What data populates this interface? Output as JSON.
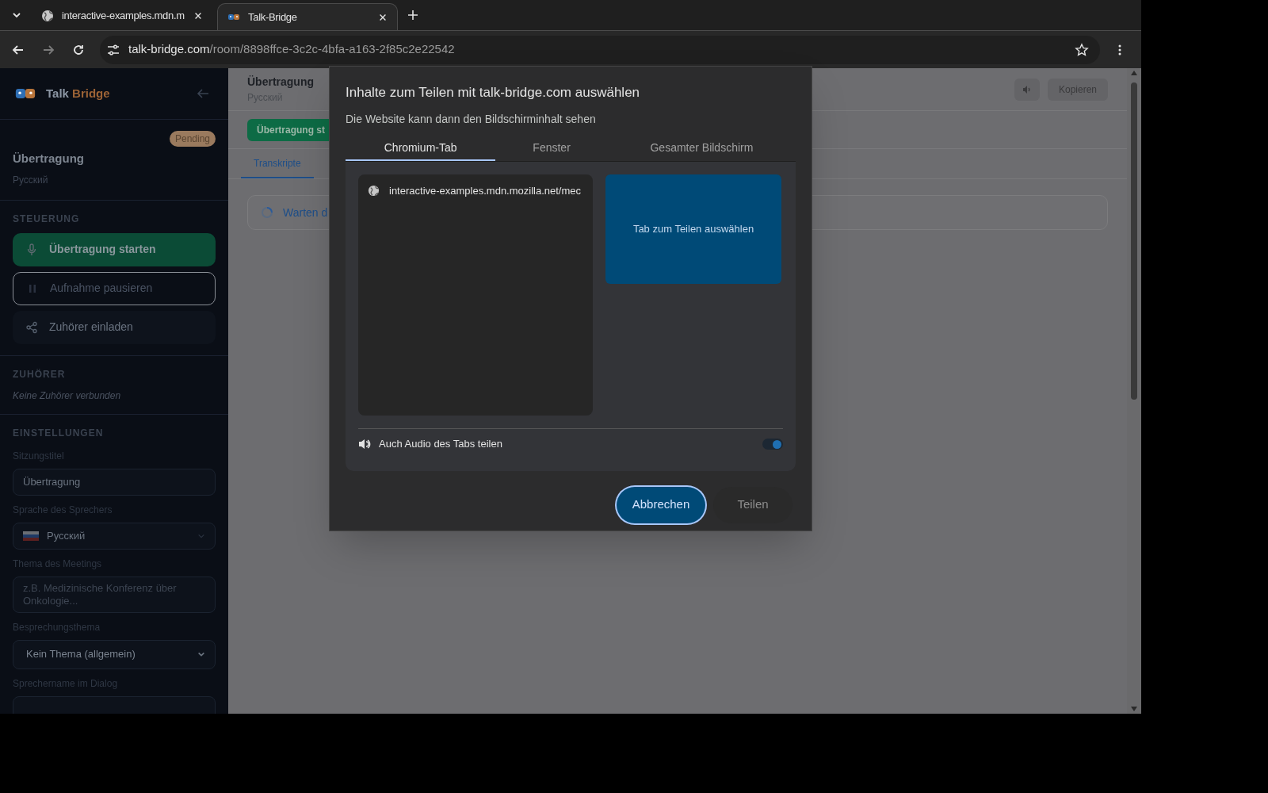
{
  "browser": {
    "tabs": [
      {
        "title": "interactive-examples.mdn.m",
        "selected": false
      },
      {
        "title": "Talk-Bridge",
        "selected": true
      }
    ],
    "address": {
      "host": "talk-bridge.com",
      "path": "/room/8898ffce-3c2c-4bfa-a163-2f85c2e22542"
    }
  },
  "sidebar": {
    "brand": {
      "first": "Talk",
      "second": "Bridge"
    },
    "status": "Pending",
    "session_title": "Übertragung",
    "session_language": "Русский",
    "sections": [
      {
        "heading": "STEUERUNG",
        "buttons": [
          {
            "label": "Übertragung starten",
            "kind": "primary"
          },
          {
            "label": "Aufnahme pausieren",
            "kind": "outline"
          },
          {
            "label": "Zuhörer einladen",
            "kind": "ghost"
          }
        ]
      },
      {
        "heading": "ZUHÖRER",
        "note": "Keine Zuhörer verbunden"
      },
      {
        "heading": "EINSTELLUNGEN",
        "fields": [
          {
            "label": "Sitzungstitel",
            "kind": "input",
            "value": "Übertragung"
          },
          {
            "label": "Sprache des Sprechers",
            "kind": "language",
            "value": "Русский"
          },
          {
            "label": "Thema des Meetings",
            "kind": "textarea",
            "placeholder": "z.B. Medizinische Konferenz über Onkologie..."
          },
          {
            "label": "Besprechungsthema",
            "kind": "select",
            "value": "Kein Thema (allgemein)"
          },
          {
            "label": "Sprechername im Dialog",
            "kind": "input"
          }
        ]
      }
    ]
  },
  "main": {
    "title": "Übertragung",
    "language": "Русский",
    "copy_button": "Kopieren",
    "start_button": "Übertragung st",
    "tabs": [
      {
        "label": "Transkripte",
        "selected": true
      }
    ],
    "waiting_text": "Warten d"
  },
  "dialog": {
    "title": "Inhalte zum Teilen mit talk-bridge.com auswählen",
    "subtitle": "Die Website kann dann den Bildschirminhalt sehen",
    "tabs": [
      {
        "label": "Chromium-Tab",
        "selected": true
      },
      {
        "label": "Fenster",
        "selected": false
      },
      {
        "label": "Gesamter Bildschirm",
        "selected": false
      }
    ],
    "sources": [
      {
        "title": "interactive-examples.mdn.mozilla.net/mec",
        "selected": false
      }
    ],
    "preview_text": "Tab zum Teilen auswählen",
    "audio": {
      "label": "Auch Audio des Tabs teilen",
      "on": true
    },
    "buttons": [
      {
        "label": "Abbrechen",
        "kind": "primary",
        "focused": true
      },
      {
        "label": "Teilen",
        "kind": "secondary",
        "focused": false
      }
    ]
  }
}
